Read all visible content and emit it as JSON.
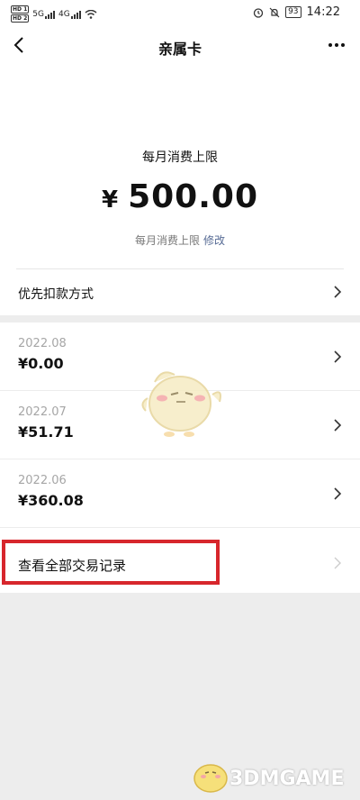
{
  "status_bar": {
    "sim1": "HD 1",
    "sim2": "HD 2",
    "net1": "5G",
    "net2": "4G",
    "battery": "93",
    "time": "14:22"
  },
  "navbar": {
    "title": "亲属卡"
  },
  "limit": {
    "label": "每月消费上限",
    "currency": "¥",
    "amount": "500.00",
    "sub_label": "每月消费上限",
    "edit_label": "修改"
  },
  "payment": {
    "label": "优先扣款方式"
  },
  "months": [
    {
      "month": "2022.08",
      "value": "¥0.00"
    },
    {
      "month": "2022.07",
      "value": "¥51.71"
    },
    {
      "month": "2022.06",
      "value": "¥360.08"
    }
  ],
  "all_records": {
    "label": "查看全部交易记录"
  },
  "watermark": {
    "text": "3DMGAME"
  },
  "colors": {
    "highlight": "#d7262c",
    "link": "#576b95",
    "background": "#ededed"
  }
}
